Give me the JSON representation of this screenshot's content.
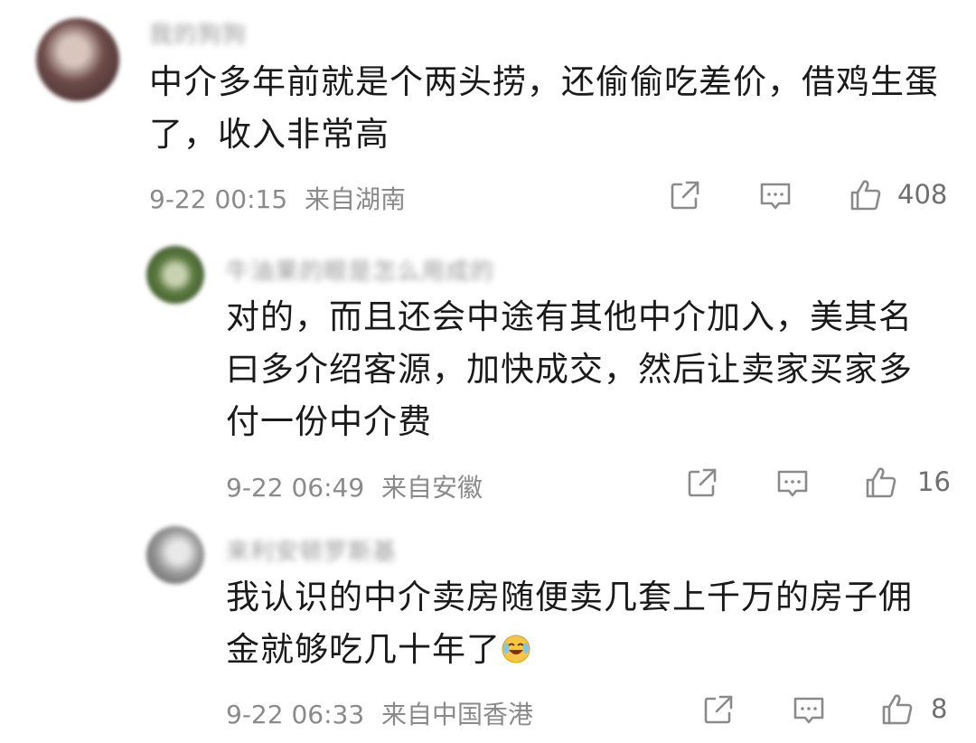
{
  "comments": [
    {
      "username": "我的狗狗",
      "text": "中介多年前就是个两头捞，还偷偷吃差价，借鸡生蛋了，收入非常高",
      "time": "9-22 00:15",
      "location": "来自湖南",
      "likes": "408",
      "avatar_color": "#7a5a58"
    },
    {
      "username": "牛油果的眼是怎么用成的",
      "text": "对的，而且还会中途有其他中介加入，美其名曰多介绍客源，加快成交，然后让卖家买家多付一份中介费",
      "time": "9-22 06:49",
      "location": "来自安徽",
      "likes": "16",
      "avatar_color": "#4e6b3a"
    },
    {
      "username": "来利安顿罗斯基",
      "text": "我认识的中介卖房随便卖几套上千万的房子佣金就够吃几十年了",
      "time": "9-22 06:33",
      "location": "来自中国香港",
      "likes": "8",
      "avatar_color": "#8c8c8c"
    }
  ],
  "icons": {
    "share": "share-icon",
    "reply": "comment-icon",
    "like": "thumbs-up-icon",
    "emoji": "laughing-crying-emoji"
  }
}
